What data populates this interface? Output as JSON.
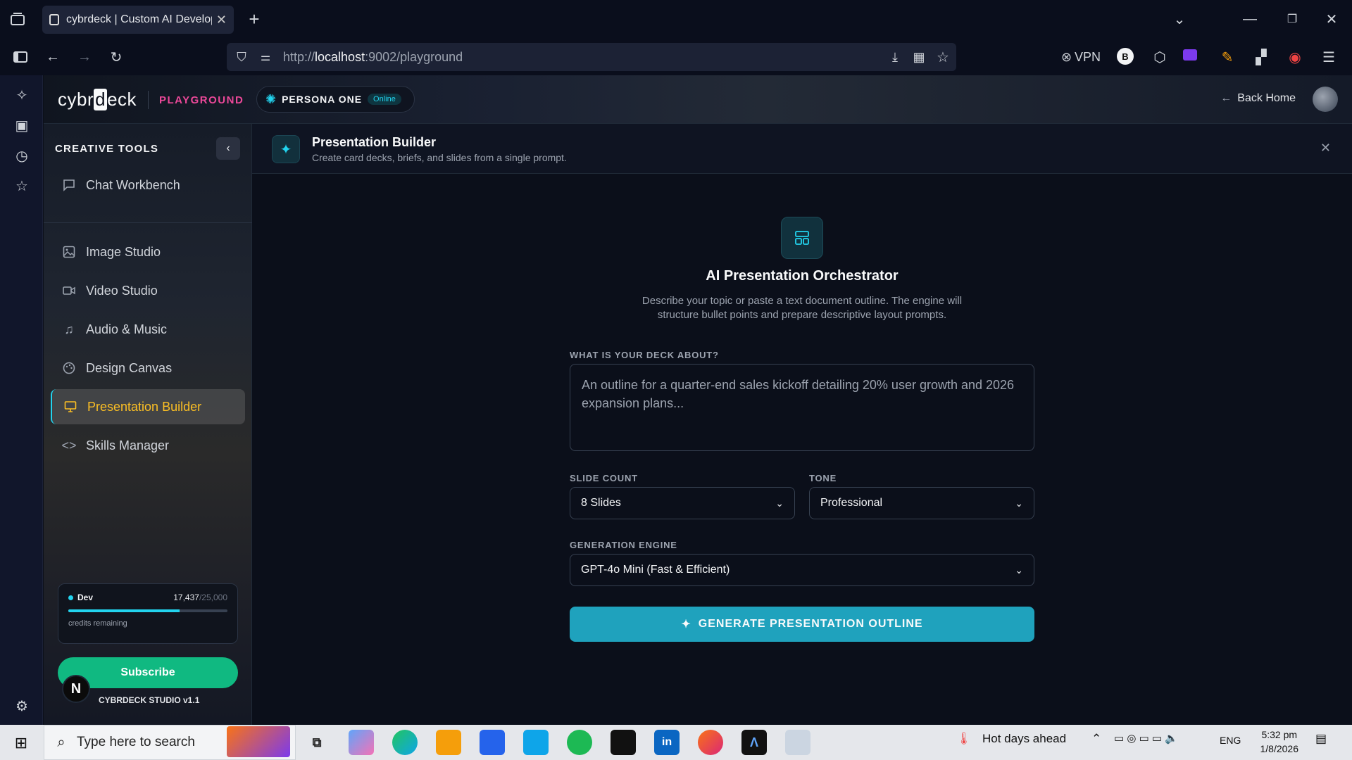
{
  "browser": {
    "tab_title": "cybrdeck | Custom AI Developm",
    "url_prefix": "http://",
    "url_host": "localhost",
    "url_rest": ":9002/playground",
    "vpn_label": "VPN"
  },
  "header": {
    "logo_pre": "cybr",
    "logo_box": "d",
    "logo_post": "eck",
    "section": "PLAYGROUND",
    "persona_name": "PERSONA ONE",
    "persona_status": "Online",
    "back_home": "Back Home"
  },
  "sidebar": {
    "title": "CREATIVE TOOLS",
    "items": [
      {
        "label": "Chat Workbench",
        "icon": "chat-icon"
      },
      {
        "label": "Image Studio",
        "icon": "image-icon"
      },
      {
        "label": "Video Studio",
        "icon": "video-icon"
      },
      {
        "label": "Audio & Music",
        "icon": "music-icon"
      },
      {
        "label": "Design Canvas",
        "icon": "palette-icon"
      },
      {
        "label": "Presentation Builder",
        "icon": "presentation-icon",
        "active": true
      },
      {
        "label": "Skills Manager",
        "icon": "code-icon"
      }
    ],
    "credits": {
      "plan": "Dev",
      "used": "17,437",
      "max": "/25,000",
      "fraction": 0.6975,
      "label": "credits remaining"
    },
    "subscribe": "Subscribe",
    "avatar_letter": "N",
    "version": "CYBRDECK STUDIO v1.1"
  },
  "main": {
    "header_title": "Presentation Builder",
    "header_sub": "Create card decks, briefs, and slides from a single prompt.",
    "title": "AI Presentation Orchestrator",
    "desc": "Describe your topic or paste a text document outline. The engine will structure bullet points and prepare descriptive layout prompts.",
    "deck_label": "WHAT IS YOUR DECK ABOUT?",
    "deck_placeholder": "An outline for a quarter-end sales kickoff detailing 20% user growth and 2026 expansion plans...",
    "slide_count_label": "SLIDE COUNT",
    "slide_count_value": "8 Slides",
    "tone_label": "TONE",
    "tone_value": "Professional",
    "engine_label": "GENERATION ENGINE",
    "engine_value": "GPT-4o Mini (Fast & Efficient)",
    "generate_button": "GENERATE PRESENTATION OUTLINE"
  },
  "taskbar": {
    "search_placeholder": "Type here to search",
    "weather": "Hot days ahead",
    "lang": "ENG",
    "time": "5:32 pm",
    "date": "1/8/2026"
  },
  "colors": {
    "accent": "#22d3ee",
    "brand_pink": "#ec4899",
    "active_text": "#fbbf24",
    "subscribe": "#10b981",
    "generate": "#1fa2bd"
  }
}
